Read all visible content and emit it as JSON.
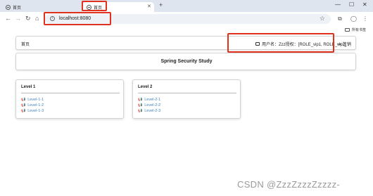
{
  "browser": {
    "tabs": [
      {
        "title": "首页",
        "active": false
      },
      {
        "title": "首页",
        "active": true
      }
    ],
    "new_tab": "+",
    "window_controls": {
      "minimize": "—",
      "maximize": "☐",
      "close": "✕"
    },
    "address": "localhost:8080",
    "bookmarks_label": "所有书签",
    "highlight_color": "#e0301e"
  },
  "page": {
    "nav": {
      "home": "首页",
      "user_label": "用户名：Zzz授权：[ROLE_vip1, ROLE_vip2]",
      "logout": "注销"
    },
    "title": "Spring Security Study",
    "levels": [
      {
        "heading": "Level 1",
        "links": [
          "Level-1-1",
          "Level-1-2",
          "Level-1-3"
        ]
      },
      {
        "heading": "Level 2",
        "links": [
          "Level-2-1",
          "Level-2-2",
          "Level-2-3"
        ]
      }
    ],
    "link_color": "#4183c4"
  },
  "watermark": "CSDN @ZzzZzzzZzzzz-"
}
